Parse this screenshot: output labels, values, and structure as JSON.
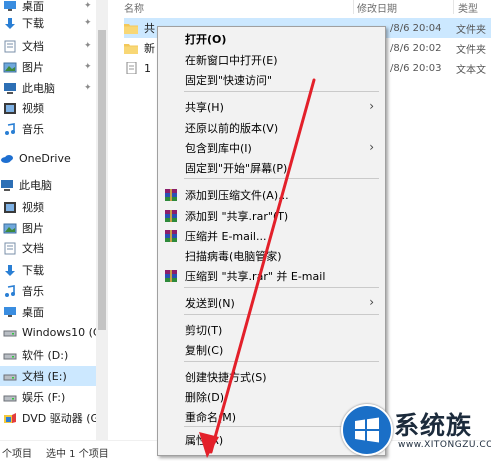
{
  "nav": {
    "items": [
      {
        "label": "桌面",
        "icon": "desktop-icon",
        "pinned": true
      },
      {
        "label": "下载",
        "icon": "download-icon",
        "pinned": true
      },
      {
        "label": "文档",
        "icon": "document-icon",
        "pinned": true
      },
      {
        "label": "图片",
        "icon": "pictures-icon",
        "pinned": true
      },
      {
        "label": "此电脑",
        "icon": "computer-icon",
        "pinned": true
      },
      {
        "label": "视频",
        "icon": "video-icon",
        "pinned": false
      },
      {
        "label": "音乐",
        "icon": "music-icon",
        "pinned": false
      },
      {
        "label": "OneDrive",
        "icon": "onedrive-icon",
        "pinned": false
      },
      {
        "label": "此电脑",
        "icon": "computer-icon",
        "pinned": false
      },
      {
        "label": "视频",
        "icon": "video-icon",
        "pinned": false
      },
      {
        "label": "图片",
        "icon": "pictures-icon",
        "pinned": false
      },
      {
        "label": "文档",
        "icon": "document-icon",
        "pinned": false
      },
      {
        "label": "下载",
        "icon": "download-icon",
        "pinned": false
      },
      {
        "label": "音乐",
        "icon": "music-icon",
        "pinned": false
      },
      {
        "label": "桌面",
        "icon": "desktop-icon",
        "pinned": false
      },
      {
        "label": "Windows10 (C:",
        "icon": "drive-icon",
        "pinned": false
      },
      {
        "label": "软件 (D:)",
        "icon": "drive-icon",
        "pinned": false
      },
      {
        "label": "文档 (E:)",
        "icon": "drive-icon",
        "pinned": false,
        "selected": true
      },
      {
        "label": "娱乐 (F:)",
        "icon": "drive-icon",
        "pinned": false
      },
      {
        "label": "DVD 驱动器 (G:",
        "icon": "dvd-drive-icon",
        "pinned": false
      }
    ]
  },
  "columns": {
    "name": "名称",
    "modified": "修改日期",
    "type": "类型"
  },
  "files": [
    {
      "name": "共",
      "date": "/8/6 20:04",
      "type": "文件夹",
      "icon": "folder-icon",
      "selected": true
    },
    {
      "name": "新",
      "date": "/8/6 20:02",
      "type": "文件夹",
      "icon": "folder-icon",
      "selected": false
    },
    {
      "name": "1",
      "date": "/8/6 20:03",
      "type": "文本文",
      "icon": "text-file-icon",
      "selected": false
    }
  ],
  "statusbar": {
    "count": "个项目",
    "selection": "选中 1 个项目"
  },
  "context_menu": {
    "groups": [
      [
        {
          "label": "打开(O)",
          "bold": true
        },
        {
          "label": "在新窗口中打开(E)"
        },
        {
          "label": "固定到\"快速访问\""
        }
      ],
      [
        {
          "label": "共享(H)",
          "submenu": true
        },
        {
          "label": "还原以前的版本(V)"
        },
        {
          "label": "包含到库中(I)",
          "submenu": true
        },
        {
          "label": "固定到\"开始\"屏幕(P)"
        }
      ],
      [
        {
          "label": "添加到压缩文件(A)...",
          "icon": "winrar-icon"
        },
        {
          "label": "添加到 \"共享.rar\"(T)",
          "icon": "winrar-icon"
        },
        {
          "label": "压缩并 E-mail...",
          "icon": "winrar-icon"
        },
        {
          "label": "扫描病毒(电脑管家)"
        },
        {
          "label": "压缩到 \"共享.rar\" 并 E-mail",
          "icon": "winrar-icon"
        }
      ],
      [
        {
          "label": "发送到(N)",
          "submenu": true
        }
      ],
      [
        {
          "label": "剪切(T)"
        },
        {
          "label": "复制(C)"
        }
      ],
      [
        {
          "label": "创建快捷方式(S)"
        },
        {
          "label": "删除(D)"
        },
        {
          "label": "重命名(M)"
        }
      ],
      [
        {
          "label": "属性(R)"
        }
      ]
    ]
  },
  "watermark": {
    "brand": "系统族",
    "url": "www.XITONGZU.COM"
  },
  "colors": {
    "selection": "#cce8ff",
    "menu_bg": "#f2f2f2",
    "arrow": "#e3202a",
    "brand_blue": "#1a6fc7"
  }
}
